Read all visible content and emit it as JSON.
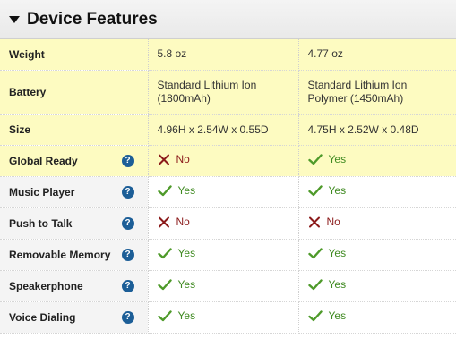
{
  "section": {
    "title": "Device Features"
  },
  "rows": [
    {
      "label": "Weight",
      "help": false,
      "a": {
        "text": "5.8 oz"
      },
      "b": {
        "text": "4.77 oz"
      }
    },
    {
      "label": "Battery",
      "help": false,
      "a": {
        "text": "Standard Lithium Ion (1800mAh)"
      },
      "b": {
        "text": "Standard Lithium Ion Polymer (1450mAh)"
      }
    },
    {
      "label": "Size",
      "help": false,
      "a": {
        "text": "4.96H x 2.54W x 0.55D"
      },
      "b": {
        "text": "4.75H x 2.52W x 0.48D"
      }
    },
    {
      "label": "Global Ready",
      "help": true,
      "a": {
        "text": "No",
        "status": "no"
      },
      "b": {
        "text": "Yes",
        "status": "yes"
      }
    },
    {
      "label": "Music Player",
      "help": true,
      "a": {
        "text": "Yes",
        "status": "yes"
      },
      "b": {
        "text": "Yes",
        "status": "yes"
      }
    },
    {
      "label": "Push to Talk",
      "help": true,
      "a": {
        "text": "No",
        "status": "no"
      },
      "b": {
        "text": "No",
        "status": "no"
      }
    },
    {
      "label": "Removable Memory",
      "help": true,
      "a": {
        "text": "Yes",
        "status": "yes"
      },
      "b": {
        "text": "Yes",
        "status": "yes"
      }
    },
    {
      "label": "Speakerphone",
      "help": true,
      "a": {
        "text": "Yes",
        "status": "yes"
      },
      "b": {
        "text": "Yes",
        "status": "yes"
      }
    },
    {
      "label": "Voice Dialing",
      "help": true,
      "a": {
        "text": "Yes",
        "status": "yes"
      },
      "b": {
        "text": "Yes",
        "status": "yes"
      }
    }
  ],
  "help_icon": {
    "glyph": "?",
    "name": "help-icon"
  },
  "colors": {
    "yes": "#3f8a21",
    "no": "#8b1a1a",
    "highlight": "#fdfbc1",
    "help": "#1c5e97"
  }
}
